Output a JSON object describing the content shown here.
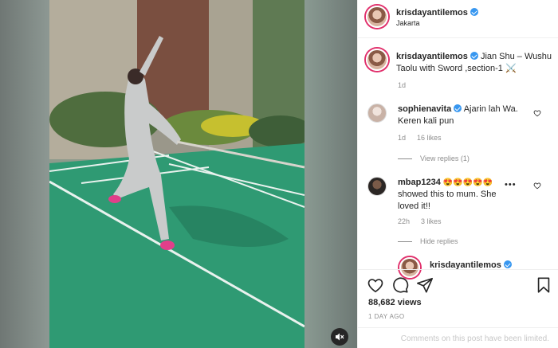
{
  "post": {
    "username": "krisdayantilemos",
    "location": "Jakarta",
    "caption": "Jian Shu – Wushu Taolu with Sword ,section-1 ⚔️",
    "caption_age": "1d"
  },
  "comments": [
    {
      "username": "sophienavita",
      "verified": true,
      "text": "Ajarin lah Wa. Keren kali pun",
      "age": "1d",
      "likes": "16 likes",
      "replies_label": "View replies (1)"
    },
    {
      "username": "mbap1234",
      "emojis": "😍😍😍😍😍",
      "text": "showed this to mum. She loved it!!",
      "more": "•••",
      "age": "22h",
      "likes": "3 likes",
      "replies_label": "Hide replies"
    }
  ],
  "reply": {
    "username": "krisdayantilemos"
  },
  "stats": {
    "views": "88,682 views",
    "posted": "1 DAY AGO"
  },
  "footer": {
    "limited_text": "Comments on this post have been limited."
  },
  "colors": {
    "court_green": "#2f9a73",
    "verified_blue": "#3897f0",
    "story_ring": "#e1306c"
  }
}
